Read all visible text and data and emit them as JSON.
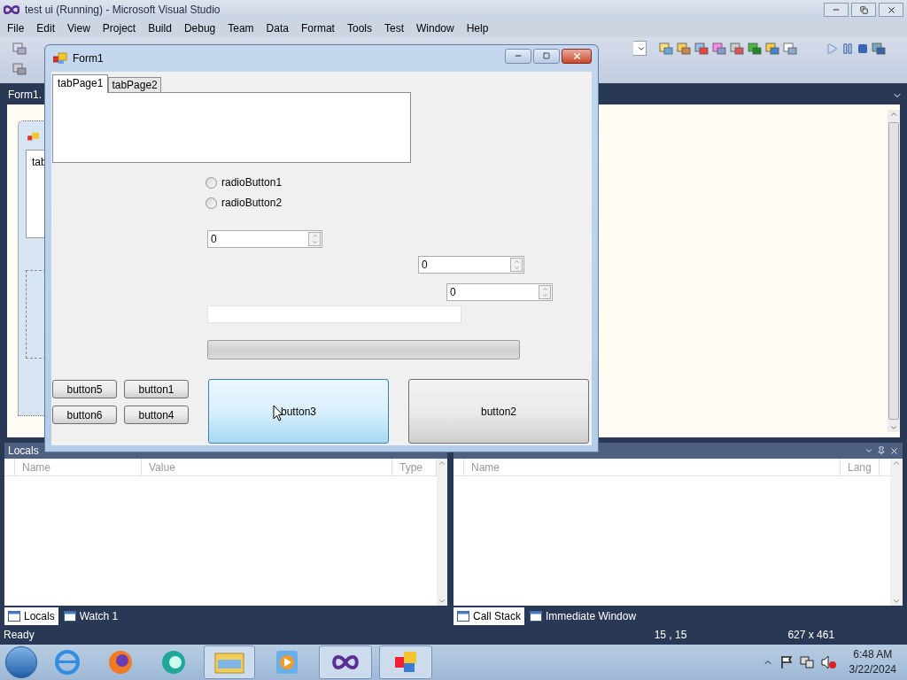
{
  "window": {
    "title": "test ui (Running) - Microsoft Visual Studio"
  },
  "menu": [
    "File",
    "Edit",
    "View",
    "Project",
    "Build",
    "Debug",
    "Team",
    "Data",
    "Format",
    "Tools",
    "Test",
    "Window",
    "Help"
  ],
  "document_tabs": [
    {
      "label": "Form1.",
      "selected": true
    }
  ],
  "designer": {
    "tab_label": "tab"
  },
  "form": {
    "title": "Form1",
    "tabs": [
      {
        "label": "tabPage1",
        "selected": true
      },
      {
        "label": "tabPage2",
        "selected": false
      }
    ],
    "radio_buttons": [
      {
        "label": "radioButton1",
        "checked": false
      },
      {
        "label": "radioButton2",
        "checked": false
      }
    ],
    "numeric_fields": [
      {
        "value": "0"
      },
      {
        "value": "0"
      },
      {
        "value": "0"
      }
    ],
    "progress": {
      "level": 0
    },
    "buttons": [
      {
        "label": "button5",
        "hovered": false
      },
      {
        "label": "button1",
        "hovered": false
      },
      {
        "label": "button6",
        "hovered": false
      },
      {
        "label": "button4",
        "hovered": false
      },
      {
        "label": "button3",
        "hovered": true
      },
      {
        "label": "button2",
        "hovered": false
      }
    ]
  },
  "locals_panel": {
    "title": "Locals",
    "columns": [
      "Name",
      "Value",
      "Type"
    ],
    "tabs": [
      {
        "label": "Locals",
        "selected": true
      },
      {
        "label": "Watch 1",
        "selected": false
      }
    ]
  },
  "call_stack_panel": {
    "columns": [
      "Name",
      "Lang"
    ],
    "tabs": [
      {
        "label": "Call Stack",
        "selected": true
      },
      {
        "label": "Immediate Window",
        "selected": false
      }
    ]
  },
  "status_bar": {
    "text": "Ready",
    "position": "15 , 15",
    "size": "627 x 461"
  },
  "taskbar": {
    "time": "6:48 AM",
    "date": "3/22/2024"
  }
}
